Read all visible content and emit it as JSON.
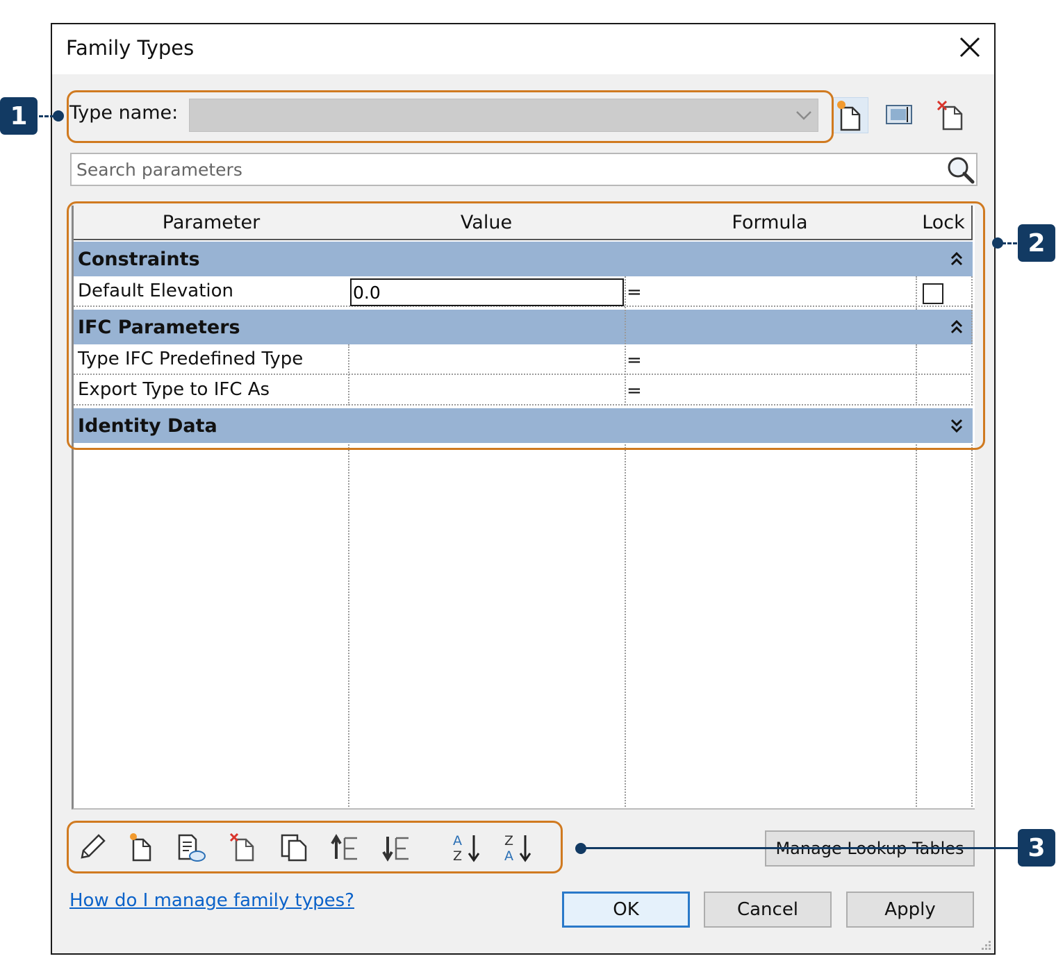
{
  "window": {
    "title": "Family Types"
  },
  "type_name": {
    "label": "Type name:",
    "value": ""
  },
  "search": {
    "placeholder": "Search parameters"
  },
  "grid": {
    "columns": [
      "Parameter",
      "Value",
      "Formula",
      "Lock"
    ],
    "groups": [
      {
        "name": "Constraints",
        "state": "expanded",
        "rows": [
          {
            "parameter": "Default Elevation",
            "value": "0.0",
            "formula": "=",
            "lock": false
          }
        ]
      },
      {
        "name": "IFC Parameters",
        "state": "expanded",
        "rows": [
          {
            "parameter": "Type IFC Predefined Type",
            "value": "",
            "formula": "="
          },
          {
            "parameter": "Export Type to IFC As",
            "value": "",
            "formula": "="
          }
        ]
      },
      {
        "name": "Identity Data",
        "state": "collapsed",
        "rows": []
      }
    ]
  },
  "toolbar": {
    "icons": [
      "edit-parameter-icon",
      "new-parameter-icon",
      "shared-parameters-icon",
      "delete-parameter-icon",
      "duplicate-parameter-icon",
      "move-up-icon",
      "move-down-icon",
      "sort-ascending-icon",
      "sort-descending-icon"
    ],
    "manage_lookup_label": "Manage Lookup Tables"
  },
  "help": {
    "link_text": "How do I manage family types?"
  },
  "buttons": {
    "ok": "OK",
    "cancel": "Cancel",
    "apply": "Apply"
  },
  "callouts": [
    "1",
    "2",
    "3"
  ],
  "colors": {
    "callout_box": "#d07a20",
    "badge": "#123a63",
    "group_header": "#98b3d3",
    "link": "#0b62c9"
  }
}
